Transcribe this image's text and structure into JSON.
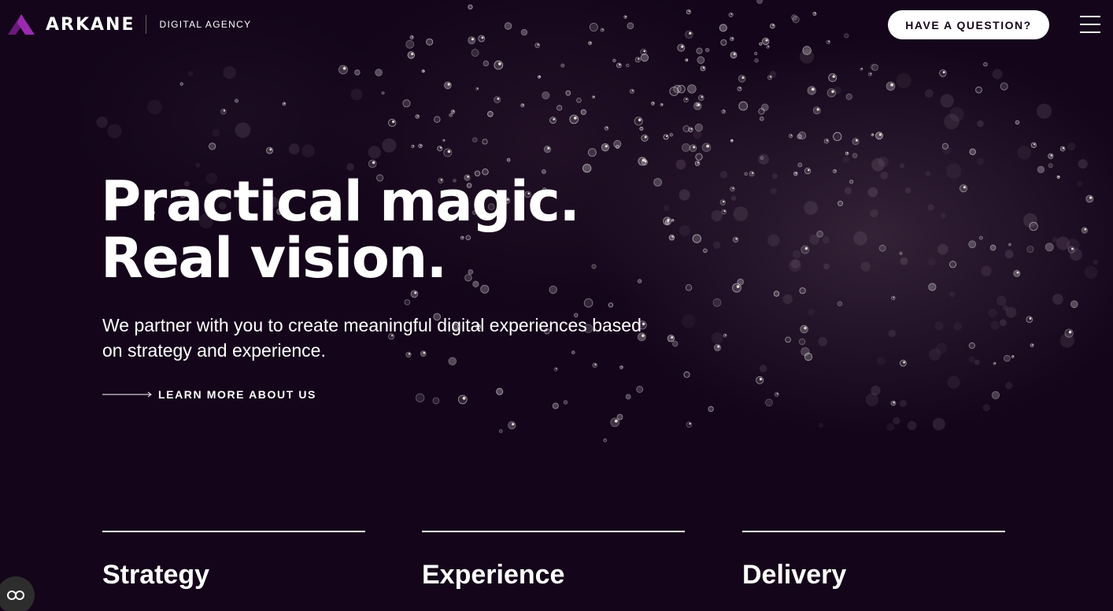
{
  "header": {
    "logo_text": "ARKANE",
    "logo_tagline": "DIGITAL AGENCY",
    "question_button": "HAVE A QUESTION?",
    "menu_icon": "hamburger-menu-icon"
  },
  "hero": {
    "headline_line1": "Practical magic.",
    "headline_line2": "Real vision.",
    "subtext": "We partner with you to create meaningful digital experiences based on strategy and experience.",
    "cta_label": "LEARN MORE ABOUT US",
    "cta_icon": "long-arrow-right-icon"
  },
  "pillars": [
    {
      "title": "Strategy"
    },
    {
      "title": "Experience"
    },
    {
      "title": "Delivery"
    }
  ],
  "accessibility": {
    "icon": "glasses-icon"
  },
  "colors": {
    "background": "#14051a",
    "text": "#ffffff",
    "brand_purple": "#8a1f9b",
    "button_bg": "#ffffff"
  }
}
